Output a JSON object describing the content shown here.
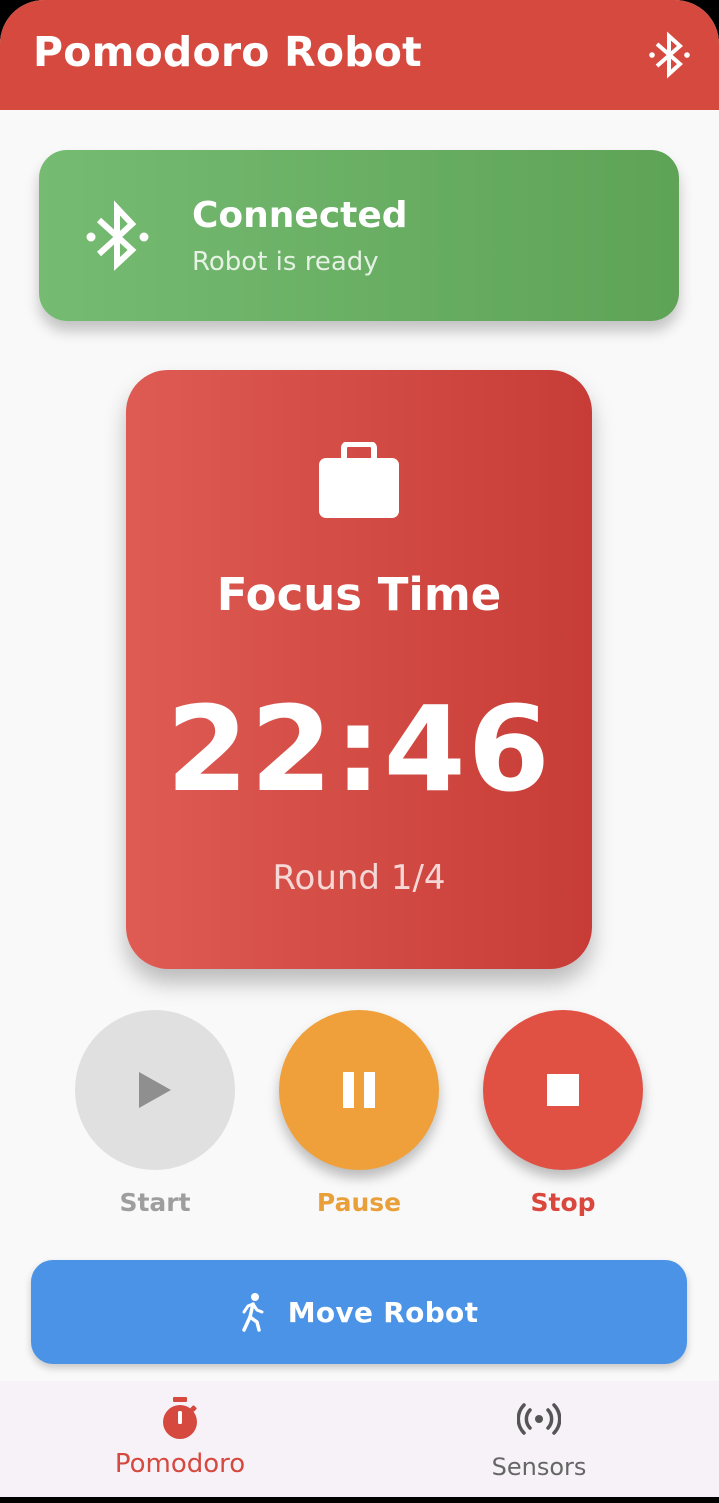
{
  "app": {
    "title": "Pomodoro Robot",
    "bluetooth_icon": "bluetooth-icon",
    "accent_color": "#d6493f"
  },
  "connection": {
    "icon": "bluetooth-connected-icon",
    "title": "Connected",
    "subtitle": "Robot is ready",
    "color": "#68ad62"
  },
  "timer": {
    "icon": "briefcase-icon",
    "phase": "Focus Time",
    "time": "22:46",
    "round": "Round 1/4"
  },
  "controls": {
    "start": {
      "label": "Start",
      "icon": "play-icon",
      "color": "#e0e0e0"
    },
    "pause": {
      "label": "Pause",
      "icon": "pause-icon",
      "color": "#efa03a"
    },
    "stop": {
      "label": "Stop",
      "icon": "stop-icon",
      "color": "#e05143"
    }
  },
  "move_button": {
    "label": "Move Robot",
    "icon": "walking-person-icon",
    "color": "#4a93e6"
  },
  "bottom_nav": {
    "pomodoro": {
      "label": "Pomodoro",
      "icon": "stopwatch-icon",
      "selected": true
    },
    "sensors": {
      "label": "Sensors",
      "icon": "sensors-broadcast-icon",
      "selected": false
    }
  }
}
